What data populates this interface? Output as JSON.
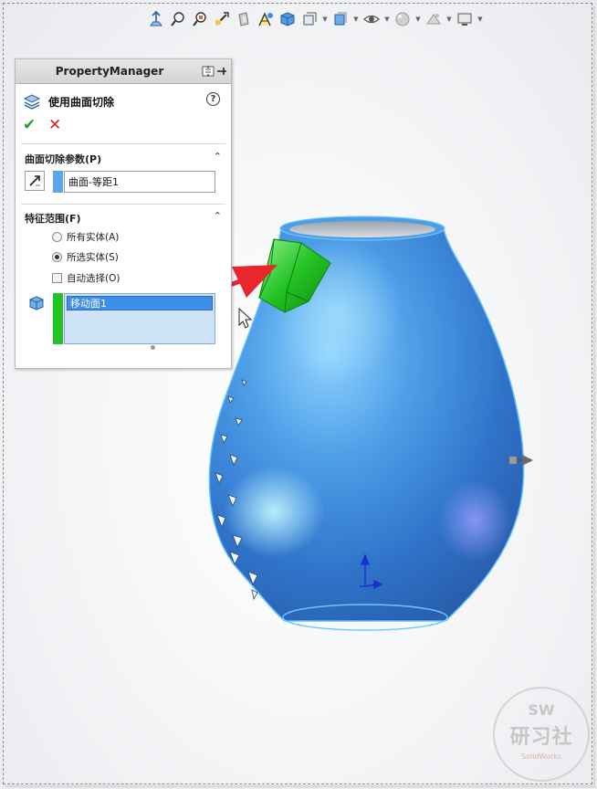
{
  "property_manager": {
    "title": "PropertyManager",
    "feature_name": "使用曲面切除",
    "help_symbol": "?",
    "ok_symbol": "✔",
    "cancel_symbol": "✕",
    "group_params": {
      "title": "曲面切除参数(P)",
      "surface_value": "曲面-等距1"
    },
    "group_scope": {
      "title": "特征范围(F)",
      "option_all": "所有实体(A)",
      "option_selected": "所选实体(S)",
      "option_auto": "自动选择(O)",
      "selected_option": "所选实体(S)",
      "auto_checked": false,
      "body_item": "移动面1"
    },
    "collapse_symbol": "⌃"
  },
  "toolbar": {
    "icons": [
      "view-normal-icon",
      "zoom-fit-icon",
      "zoom-area-icon",
      "previous-view-icon",
      "section-view-icon",
      "dynamic-annotation-icon",
      "view-orientation-icon",
      "display-style-icon",
      "hide-show-icon",
      "edit-appearance-icon",
      "apply-scene-icon",
      "view-settings-icon"
    ]
  },
  "watermark": {
    "top": "SW",
    "main": "研习社",
    "sub": "SolidWorks"
  },
  "colors": {
    "accent_blue": "#3d8ee6",
    "selection_green": "#22c322",
    "callout_red": "#e8262c",
    "part_blue": "#3f86d6"
  }
}
